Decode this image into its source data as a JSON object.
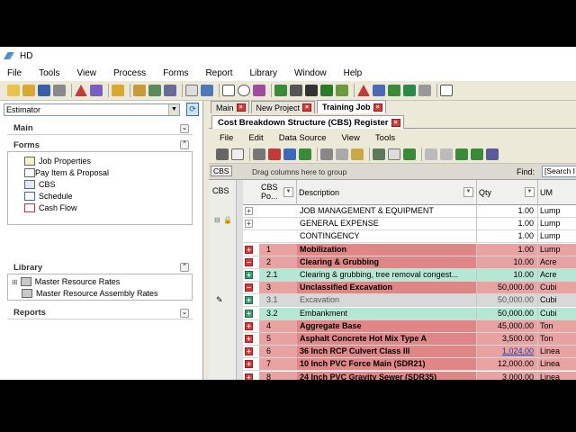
{
  "window": {
    "title": "HD"
  },
  "menu": [
    "File",
    "Tools",
    "View",
    "Process",
    "Forms",
    "Report",
    "Library",
    "Window",
    "Help"
  ],
  "estimator": {
    "value": "Estimator"
  },
  "nav": {
    "main_title": "Main",
    "forms_title": "Forms",
    "forms_items": [
      "Job Properties",
      "Pay Item & Proposal",
      "CBS",
      "Schedule",
      "Cash Flow"
    ],
    "library_title": "Library",
    "library_items": [
      "Master Resource Rates",
      "Master Resource Assembly Rates"
    ],
    "reports_title": "Reports"
  },
  "doc_tabs": [
    {
      "label": "Main",
      "active": false
    },
    {
      "label": "New Project",
      "active": false
    },
    {
      "label": "Training Job",
      "active": true
    }
  ],
  "register_tab": {
    "label": "Cost Breakdown Structure (CBS) Register"
  },
  "submenu": [
    "File",
    "Edit",
    "Data Source",
    "View",
    "Tools"
  ],
  "groupbar": {
    "tab": "CBS",
    "hint": "Drag columns here to group",
    "find_label": "Find:",
    "find_placeholder": "[Search I"
  },
  "grid": {
    "side_header": "CBS",
    "columns": [
      "CBS Po...",
      "Description",
      "Qty",
      "UM"
    ],
    "rows": [
      {
        "pm": "+",
        "pos": "",
        "desc": "JOB MANAGEMENT & EQUIPMENT",
        "qty": "1.00",
        "um": "Lump",
        "style": "plain"
      },
      {
        "pm": "+",
        "pos": "",
        "desc": "GENERAL EXPENSE",
        "qty": "1.00",
        "um": "Lump",
        "style": "plain"
      },
      {
        "pm": "",
        "pos": "",
        "desc": "CONTINGENCY",
        "qty": "1.00",
        "um": "Lump",
        "style": "plain"
      },
      {
        "pm": "+",
        "pos": "1",
        "desc": "Mobilization",
        "qty": "1.00",
        "um": "Lump",
        "style": "red"
      },
      {
        "pm": "-",
        "pos": "2",
        "desc": "Clearing & Grubbing",
        "qty": "10.00",
        "um": "Acre",
        "style": "red"
      },
      {
        "pm": "+",
        "pos": "2.1",
        "desc": "Clearing & grubbing, tree removal congest...",
        "qty": "10.00",
        "um": "Acre",
        "style": "green"
      },
      {
        "pm": "-",
        "pos": "3",
        "desc": "Unclassified Excavation",
        "qty": "50,000.00",
        "um": "Cubi",
        "style": "red"
      },
      {
        "pm": "+",
        "pos": "3.1",
        "desc": "Excavation",
        "qty": "50,000.00",
        "um": "Cubi",
        "style": "selected"
      },
      {
        "pm": "+",
        "pos": "3.2",
        "desc": "Embankment",
        "qty": "50,000.00",
        "um": "Cubi",
        "style": "green"
      },
      {
        "pm": "+",
        "pos": "4",
        "desc": "Aggregate Base",
        "qty": "45,000.00",
        "um": "Ton",
        "style": "red"
      },
      {
        "pm": "+",
        "pos": "5",
        "desc": "Asphalt Concrete Hot Mix Type A",
        "qty": "3,500.00",
        "um": "Ton",
        "style": "red"
      },
      {
        "pm": "+",
        "pos": "6",
        "desc": "36 Inch RCP Culvert Class III",
        "qty": "1,024.00",
        "um": "Linea",
        "style": "red"
      },
      {
        "pm": "+",
        "pos": "7",
        "desc": "10 Inch PVC Force Main (SDR21)",
        "qty": "12,000.00",
        "um": "Linea",
        "style": "red"
      },
      {
        "pm": "+",
        "pos": "8",
        "desc": "24 Inch PVC Gravity Sewer (SDR35)",
        "qty": "3,000.00",
        "um": "Linea",
        "style": "red"
      }
    ]
  },
  "colors": {
    "red_row": "#e9a2a2",
    "red_row_desc": "#e08686",
    "green_row": "#b5e8d4",
    "selected_row": "#d8d8d8",
    "link_qty": "#1a3fb0"
  }
}
